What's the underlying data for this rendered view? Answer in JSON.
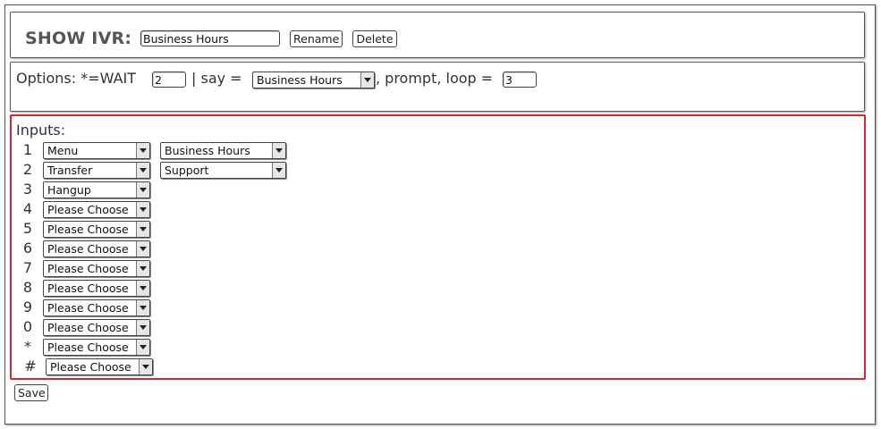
{
  "header": {
    "title": "SHOW IVR:",
    "name_value": "Business Hours",
    "rename_label": "Rename",
    "delete_label": "Delete"
  },
  "options": {
    "prefix": "Options: *=WAIT",
    "wait_value": "2",
    "say_label": "| say =",
    "say_selected": "Business Hours",
    "prompt_loop_label": ", prompt, loop =",
    "loop_value": "3"
  },
  "inputs": {
    "label": "Inputs:",
    "rows": [
      {
        "key": "1",
        "action": "Menu",
        "target": "Business Hours"
      },
      {
        "key": "2",
        "action": "Transfer",
        "target": "Support"
      },
      {
        "key": "3",
        "action": "Hangup",
        "target": null
      },
      {
        "key": "4",
        "action": "Please Choose",
        "target": null
      },
      {
        "key": "5",
        "action": "Please Choose",
        "target": null
      },
      {
        "key": "6",
        "action": "Please Choose",
        "target": null
      },
      {
        "key": "7",
        "action": "Please Choose",
        "target": null
      },
      {
        "key": "8",
        "action": "Please Choose",
        "target": null
      },
      {
        "key": "9",
        "action": "Please Choose",
        "target": null
      },
      {
        "key": "0",
        "action": "Please Choose",
        "target": null
      },
      {
        "key": "*",
        "action": "Please Choose",
        "target": null
      },
      {
        "key": "#",
        "action": "Please Choose",
        "target": null
      }
    ]
  },
  "footer": {
    "save_label": "Save"
  },
  "colors": {
    "highlight_border": "#d8282e"
  }
}
